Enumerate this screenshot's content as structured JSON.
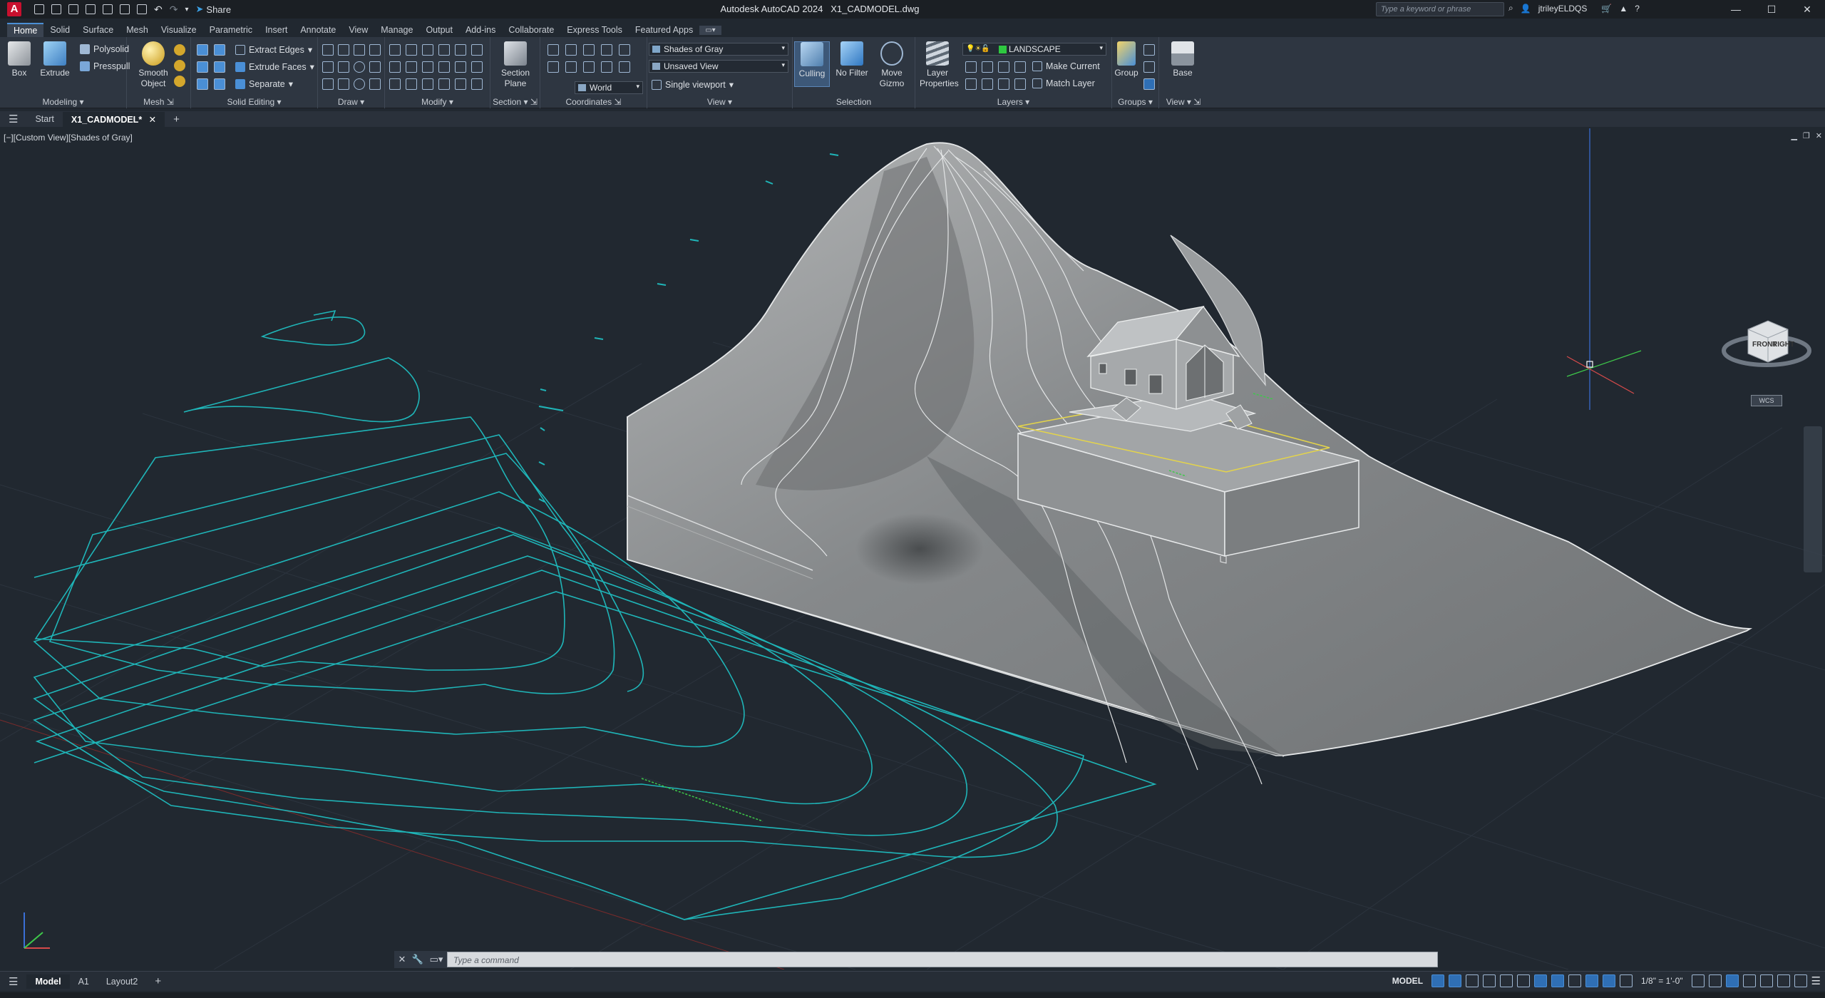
{
  "app": {
    "title": "Autodesk AutoCAD 2024",
    "filename": "X1_CADMODEL.dwg",
    "logo": "A",
    "share": "Share",
    "search_placeholder": "Type a keyword or phrase",
    "user": "jtrileyELDQS"
  },
  "ribbon_tabs": [
    "Home",
    "Solid",
    "Surface",
    "Mesh",
    "Visualize",
    "Parametric",
    "Insert",
    "Annotate",
    "View",
    "Manage",
    "Output",
    "Add-ins",
    "Collaborate",
    "Express Tools",
    "Featured Apps"
  ],
  "ribbon": {
    "modeling": {
      "title": "Modeling",
      "box": "Box",
      "extrude": "Extrude",
      "polysolid": "Polysolid",
      "presspull": "Presspull"
    },
    "mesh": {
      "title": "Mesh",
      "smooth_object_1": "Smooth",
      "smooth_object_2": "Object"
    },
    "solid_editing": {
      "title": "Solid Editing",
      "extract_edges": "Extract Edges",
      "extrude_faces": "Extrude Faces",
      "separate": "Separate"
    },
    "draw": {
      "title": "Draw"
    },
    "modify": {
      "title": "Modify"
    },
    "section": {
      "title": "Section",
      "section_plane_1": "Section",
      "section_plane_2": "Plane"
    },
    "coordinates": {
      "title": "Coordinates",
      "world": "World"
    },
    "view": {
      "title": "View",
      "visual_style": "Shades of Gray",
      "named_view": "Unsaved View",
      "viewport": "Single viewport"
    },
    "selection": {
      "title": "Selection",
      "culling": "Culling",
      "no_filter": "No Filter",
      "move_gizmo_1": "Move",
      "move_gizmo_2": "Gizmo"
    },
    "layers": {
      "title": "Layers",
      "layer_props_1": "Layer",
      "layer_props_2": "Properties",
      "current_layer": "LANDSCAPE",
      "make_current": "Make Current",
      "match_layer": "Match Layer"
    },
    "groups": {
      "title": "Groups",
      "group": "Group"
    },
    "viewpanel": {
      "title": "View",
      "base": "Base"
    }
  },
  "file_tabs": [
    "Start",
    "X1_CADMODEL*"
  ],
  "viewport": {
    "label": "[−][Custom View][Shades of Gray]",
    "cube_front": "FRONT",
    "cube_right": "RIGHT",
    "wcs": "WCS"
  },
  "command": {
    "placeholder": "Type a command"
  },
  "layout_tabs": [
    "Model",
    "A1",
    "Layout2"
  ],
  "status": {
    "space": "MODEL",
    "scale": "1/8\" = 1'-0\""
  },
  "colors": {
    "background": "#212830",
    "contour": "#1fb5b8",
    "accent": "#4a8fd6",
    "terrain": "#8a8d8f"
  }
}
